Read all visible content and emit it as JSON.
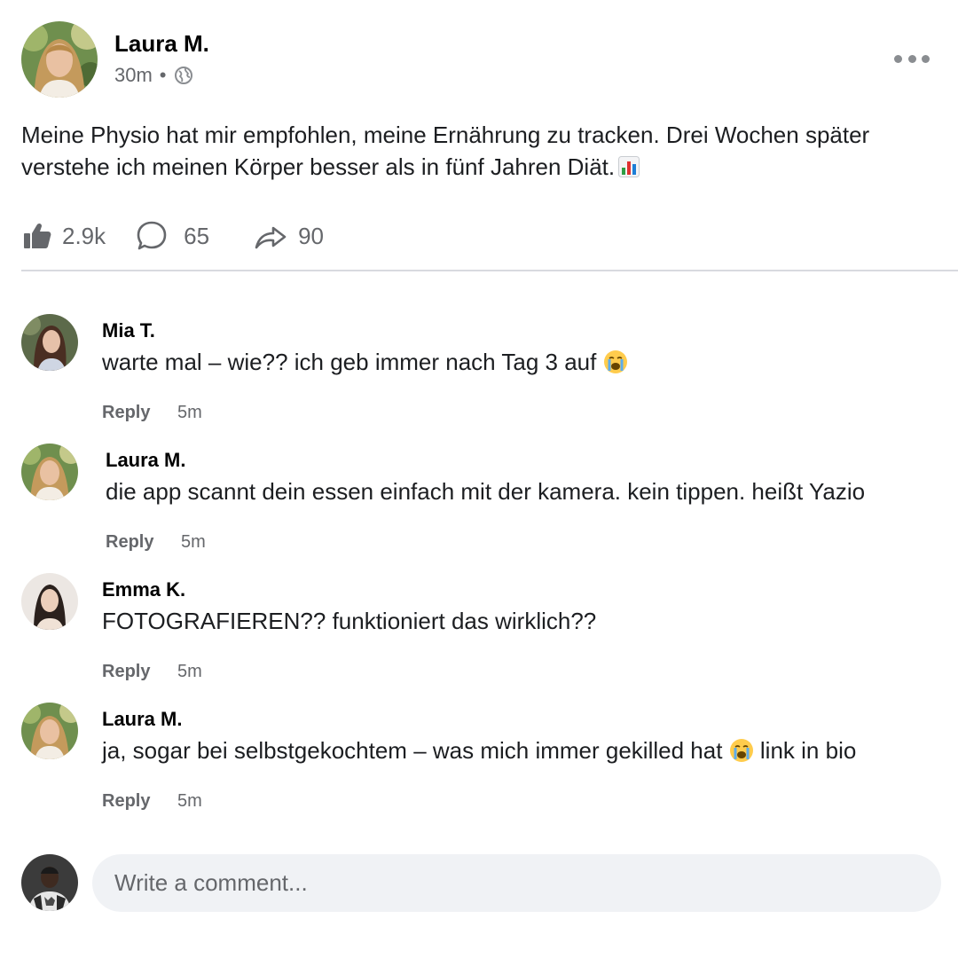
{
  "post": {
    "author": "Laura M.",
    "time": "30m",
    "separator": "•",
    "visibility_icon": "globe-icon",
    "more_icon": "more-dots-icon",
    "text": "Meine Physio hat mir empfohlen, meine Ernährung zu tracken. Drei Wochen später verstehe ich meinen Körper besser als in fünf Jahren Diät.",
    "text_emoji": "bar-chart-emoji",
    "stats": {
      "likes": "2.9k",
      "comments": "65",
      "shares": "90"
    }
  },
  "comments": [
    {
      "author": "Mia T.",
      "text": "warte mal – wie?? ich geb immer nach Tag 3 auf",
      "emoji": "loudly-crying-emoji",
      "reply_label": "Reply",
      "time": "5m"
    },
    {
      "author": "Laura M.",
      "text": "die app scannt dein essen einfach mit der kamera. kein tippen. heißt Yazio",
      "reply_label": "Reply",
      "time": "5m"
    },
    {
      "author": "Emma K.",
      "text": "FOTOGRAFIEREN?? funktioniert das wirklich??",
      "reply_label": "Reply",
      "time": "5m"
    },
    {
      "author": "Laura M.",
      "text_before": "ja, sogar bei selbstgekochtem – was mich immer gekilled hat",
      "emoji": "loudly-crying-emoji",
      "text_after": "link in bio",
      "reply_label": "Reply",
      "time": "5m"
    }
  ],
  "composer": {
    "placeholder": "Write a comment..."
  },
  "colors": {
    "secondary_text": "#65676b",
    "composer_bg": "#f0f2f5",
    "divider": "#d8dadf"
  }
}
